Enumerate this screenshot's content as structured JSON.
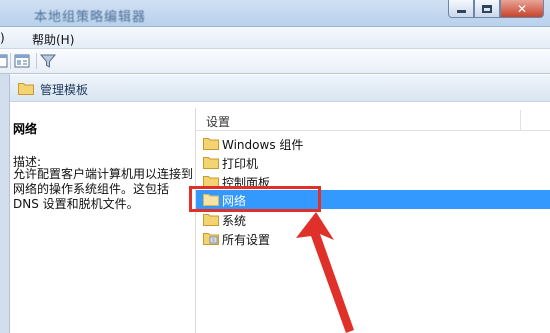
{
  "window": {
    "title": "本地组策略编辑器",
    "buttons": {
      "minimize": "minimize",
      "maximize": "maximize",
      "close": "close"
    }
  },
  "menu": {
    "help": "帮助(H)"
  },
  "toolbar": {
    "icons": [
      "view-icon",
      "properties-icon",
      "filter-icon"
    ]
  },
  "panel": {
    "header": "管理模板"
  },
  "details": {
    "title": "网络",
    "description_label": "描述:",
    "description_text": "允许配置客户端计算机用以连接到网络的操作系统组件。这包括 DNS 设置和脱机文件。"
  },
  "tree": {
    "header": "设置",
    "items": [
      {
        "label": "Windows 组件",
        "icon": "folder-icon",
        "selected": false
      },
      {
        "label": "打印机",
        "icon": "folder-icon",
        "selected": false
      },
      {
        "label": "控制面板",
        "icon": "folder-icon",
        "selected": false
      },
      {
        "label": "网络",
        "icon": "folder-icon",
        "selected": true
      },
      {
        "label": "系统",
        "icon": "folder-icon",
        "selected": false
      },
      {
        "label": "所有设置",
        "icon": "settings-folder-icon",
        "selected": false
      }
    ]
  },
  "colors": {
    "selection": "#3399ff",
    "annotation": "#e0302a",
    "folder": "#f4d372"
  }
}
